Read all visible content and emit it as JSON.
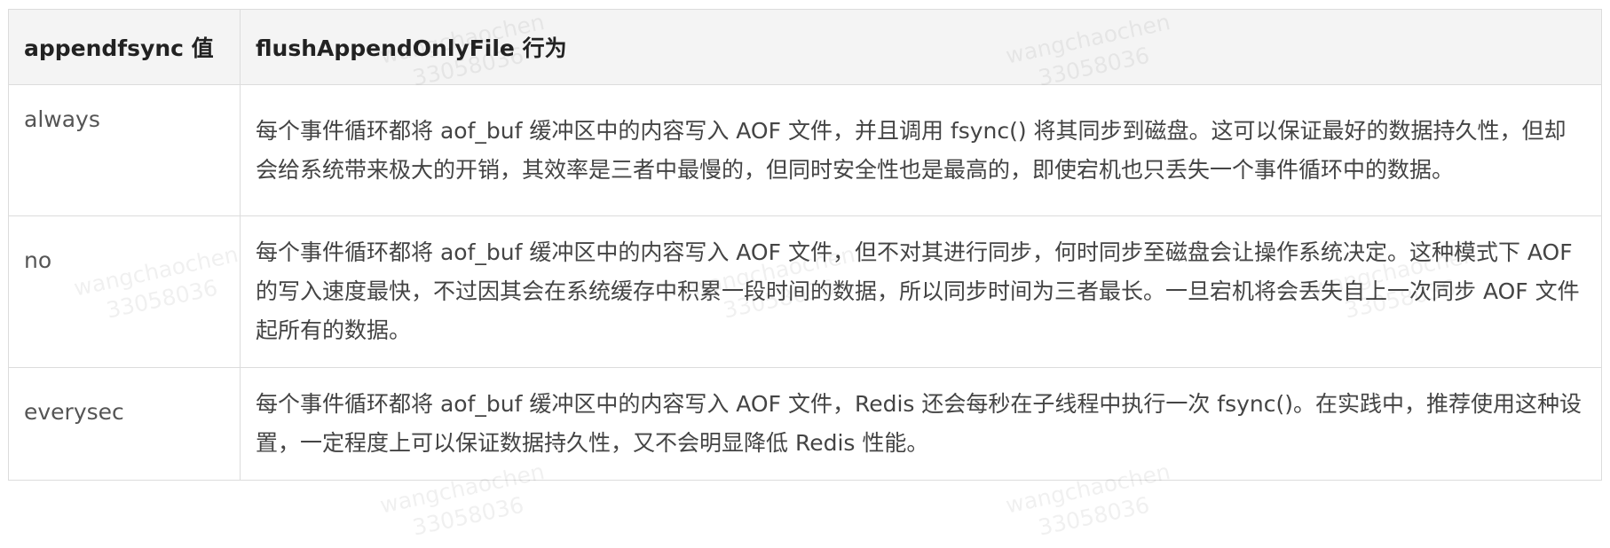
{
  "table": {
    "headers": [
      "appendfsync 值",
      "flushAppendOnlyFile 行为"
    ],
    "rows": [
      {
        "mode": "always",
        "behavior": "每个事件循环都将 aof_buf 缓冲区中的内容写入 AOF 文件，并且调用 fsync() 将其同步到磁盘。这可以保证最好的数据持久性，但却会给系统带来极大的开销，其效率是三者中最慢的，但同时安全性也是最高的，即使宕机也只丢失一个事件循环中的数据。"
      },
      {
        "mode": "no",
        "behavior": "每个事件循环都将 aof_buf 缓冲区中的内容写入 AOF 文件，但不对其进行同步，何时同步至磁盘会让操作系统决定。这种模式下 AOF 的写入速度最快，不过因其会在系统缓存中积累一段时间的数据，所以同步时间为三者最长。一旦宕机将会丢失自上一次同步 AOF 文件起所有的数据。"
      },
      {
        "mode": "everysec",
        "behavior": "每个事件循环都将 aof_buf 缓冲区中的内容写入 AOF 文件，Redis 还会每秒在子线程中执行一次 fsync()。在实践中，推荐使用这种设置，一定程度上可以保证数据持久性，又不会明显降低 Redis 性能。"
      }
    ]
  },
  "watermark": {
    "name": "wangchaochen",
    "id": "33058036"
  }
}
